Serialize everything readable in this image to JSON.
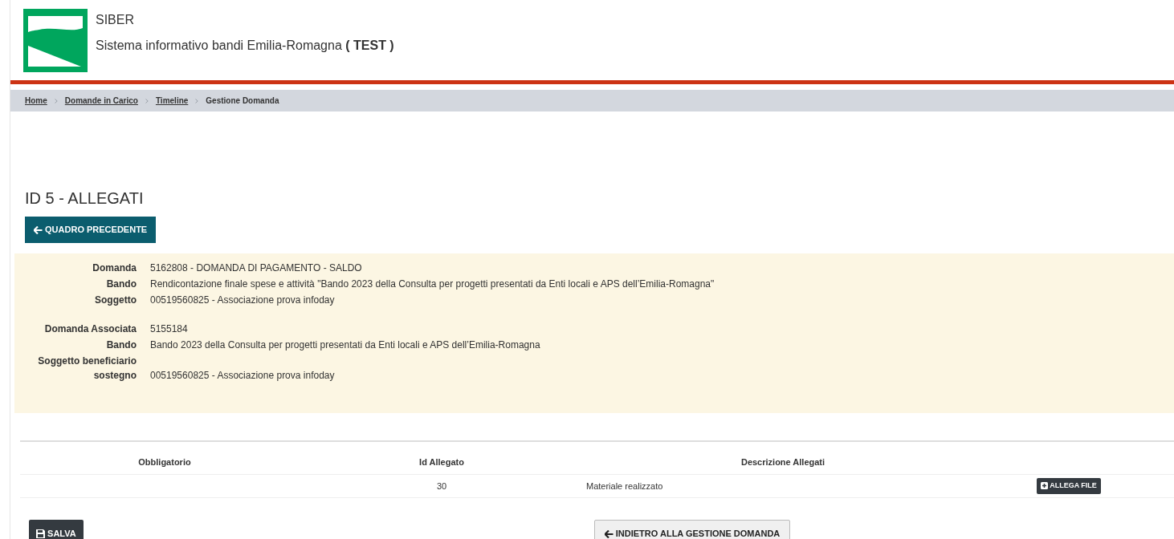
{
  "header": {
    "title": "SIBER",
    "subtitle": "Sistema informativo bandi Emilia-Romagna",
    "env": "( TEST )"
  },
  "breadcrumb": [
    {
      "label": "Home",
      "link": true
    },
    {
      "label": "Domande in Carico",
      "link": true
    },
    {
      "label": "Timeline",
      "link": true
    },
    {
      "label": "Gestione Domanda",
      "link": false
    }
  ],
  "page_title": "ID 5 - ALLEGATI",
  "back_button": "QUADRO PRECEDENTE",
  "info_groups": [
    [
      {
        "label": "Domanda",
        "value": "5162808 - DOMANDA DI PAGAMENTO - SALDO"
      },
      {
        "label": "Bando",
        "value": "Rendicontazione finale spese e attività \"Bando 2023 della Consulta per progetti presentati da Enti locali e APS dell’Emilia-Romagna\""
      },
      {
        "label": "Soggetto",
        "value": "00519560825 - Associazione prova infoday"
      }
    ],
    [
      {
        "label": "Domanda Associata",
        "value": "5155184"
      },
      {
        "label": "Bando",
        "value": "Bando 2023 della Consulta per progetti presentati da Enti locali e APS dell’Emilia-Romagna"
      },
      {
        "label": "Soggetto beneficiario sostegno",
        "value": "00519560825 - Associazione prova infoday"
      }
    ]
  ],
  "table": {
    "columns": [
      "Obbligatorio",
      "Id Allegato",
      "Descrizione Allegati"
    ],
    "rows": [
      {
        "obbligatorio": "",
        "id": "30",
        "descrizione": "Materiale realizzato",
        "action": "ALLEGA FILE"
      }
    ]
  },
  "save_button": "SALVA",
  "return_button": "INDIETRO ALLA GESTIONE DOMANDA"
}
